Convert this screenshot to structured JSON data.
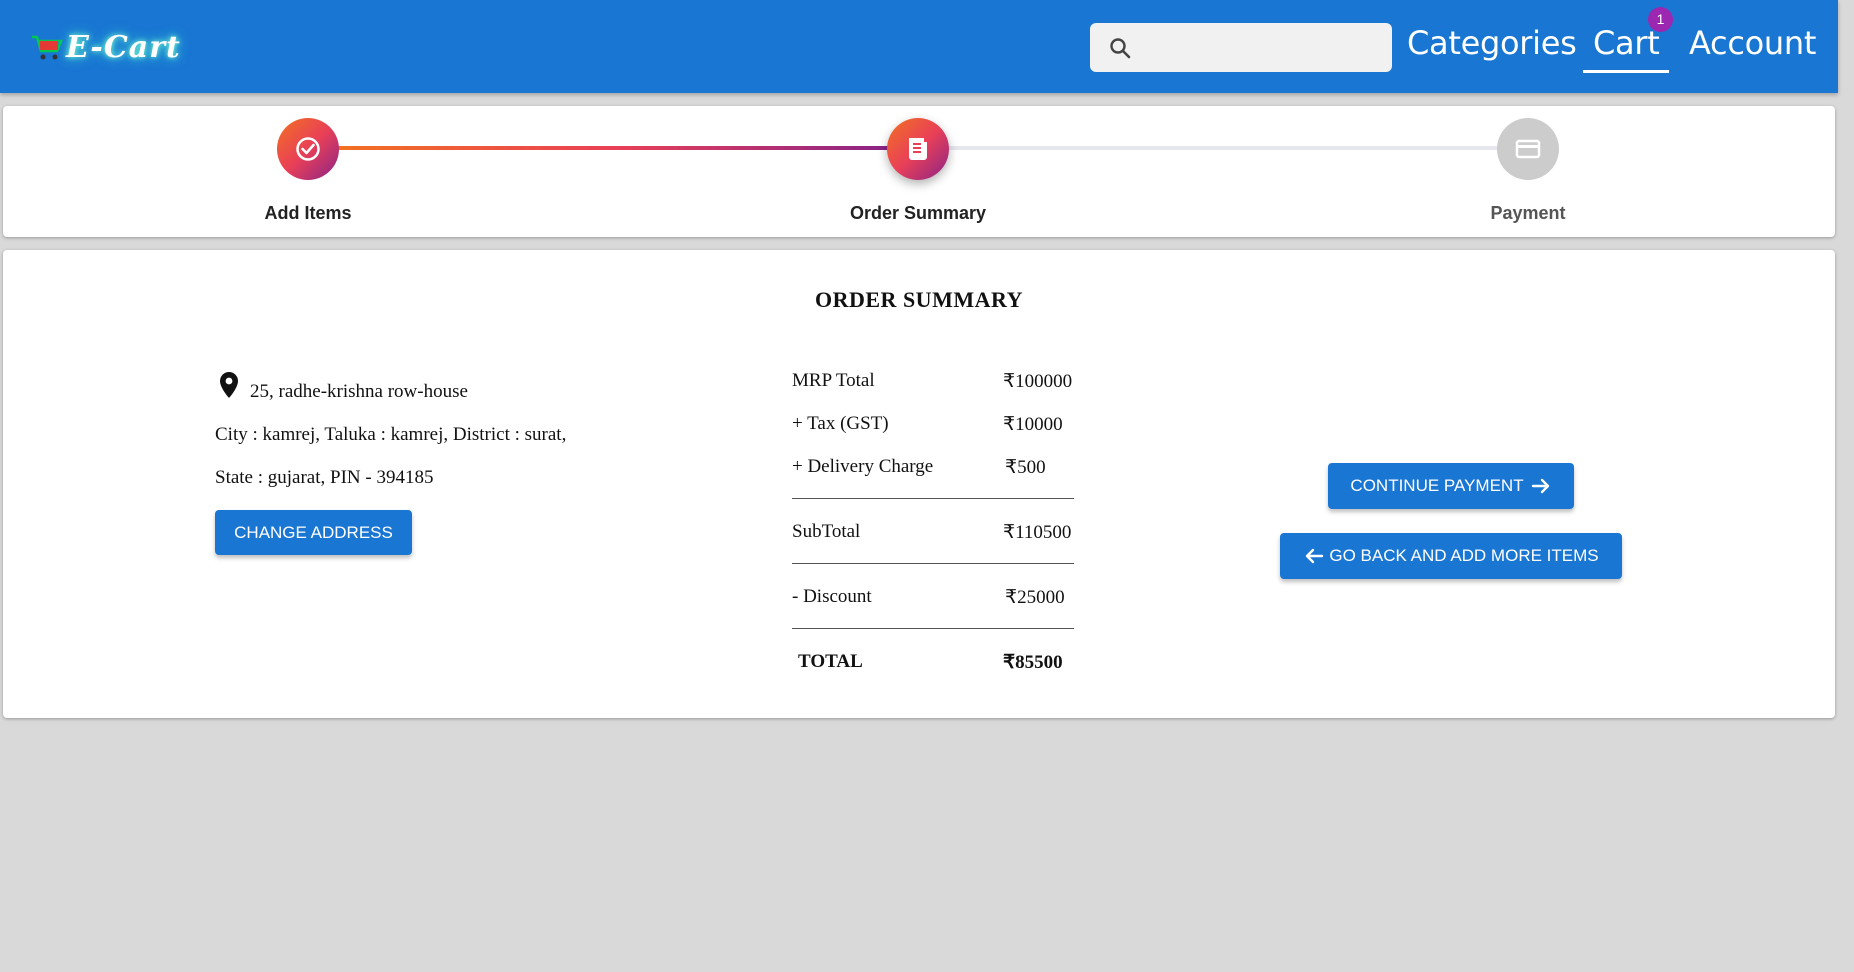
{
  "header": {
    "logo_text": "E-Cart",
    "search_placeholder": "",
    "nav": {
      "categories": "Categories",
      "cart": "Cart",
      "account": "Account"
    },
    "cart_badge": "1"
  },
  "stepper": {
    "steps": [
      {
        "label": "Add Items",
        "status": "completed",
        "icon": "check-circle-icon"
      },
      {
        "label": "Order Summary",
        "status": "active",
        "icon": "receipt-icon"
      },
      {
        "label": "Payment",
        "status": "pending",
        "icon": "credit-card-icon"
      }
    ]
  },
  "summary": {
    "title": "ORDER SUMMARY",
    "address": {
      "line1": "25, radhe-krishna row-house",
      "line2": "City : kamrej, Taluka : kamrej, District : surat,",
      "line3": "State : gujarat, PIN - 394185"
    },
    "change_address_label": "CHANGE ADDRESS",
    "prices": {
      "mrp_label": "MRP Total",
      "mrp_value": "₹100000",
      "tax_label": "+ Tax (GST)",
      "tax_value": "₹10000",
      "delivery_label": "+ Delivery Charge",
      "delivery_value": "₹500",
      "subtotal_label": "SubTotal",
      "subtotal_value": "₹110500",
      "discount_label": "- Discount",
      "discount_value": "₹25000",
      "total_label": "TOTAL",
      "total_value": "₹85500"
    },
    "continue_label": "CONTINUE PAYMENT",
    "back_label": "GO BACK AND ADD MORE ITEMS"
  },
  "colors": {
    "appbar": "#1976d2",
    "badge": "#9c27b0",
    "step_gradient": [
      "#f27121",
      "#e94057",
      "#8a2387"
    ],
    "button": "#1976d2"
  }
}
